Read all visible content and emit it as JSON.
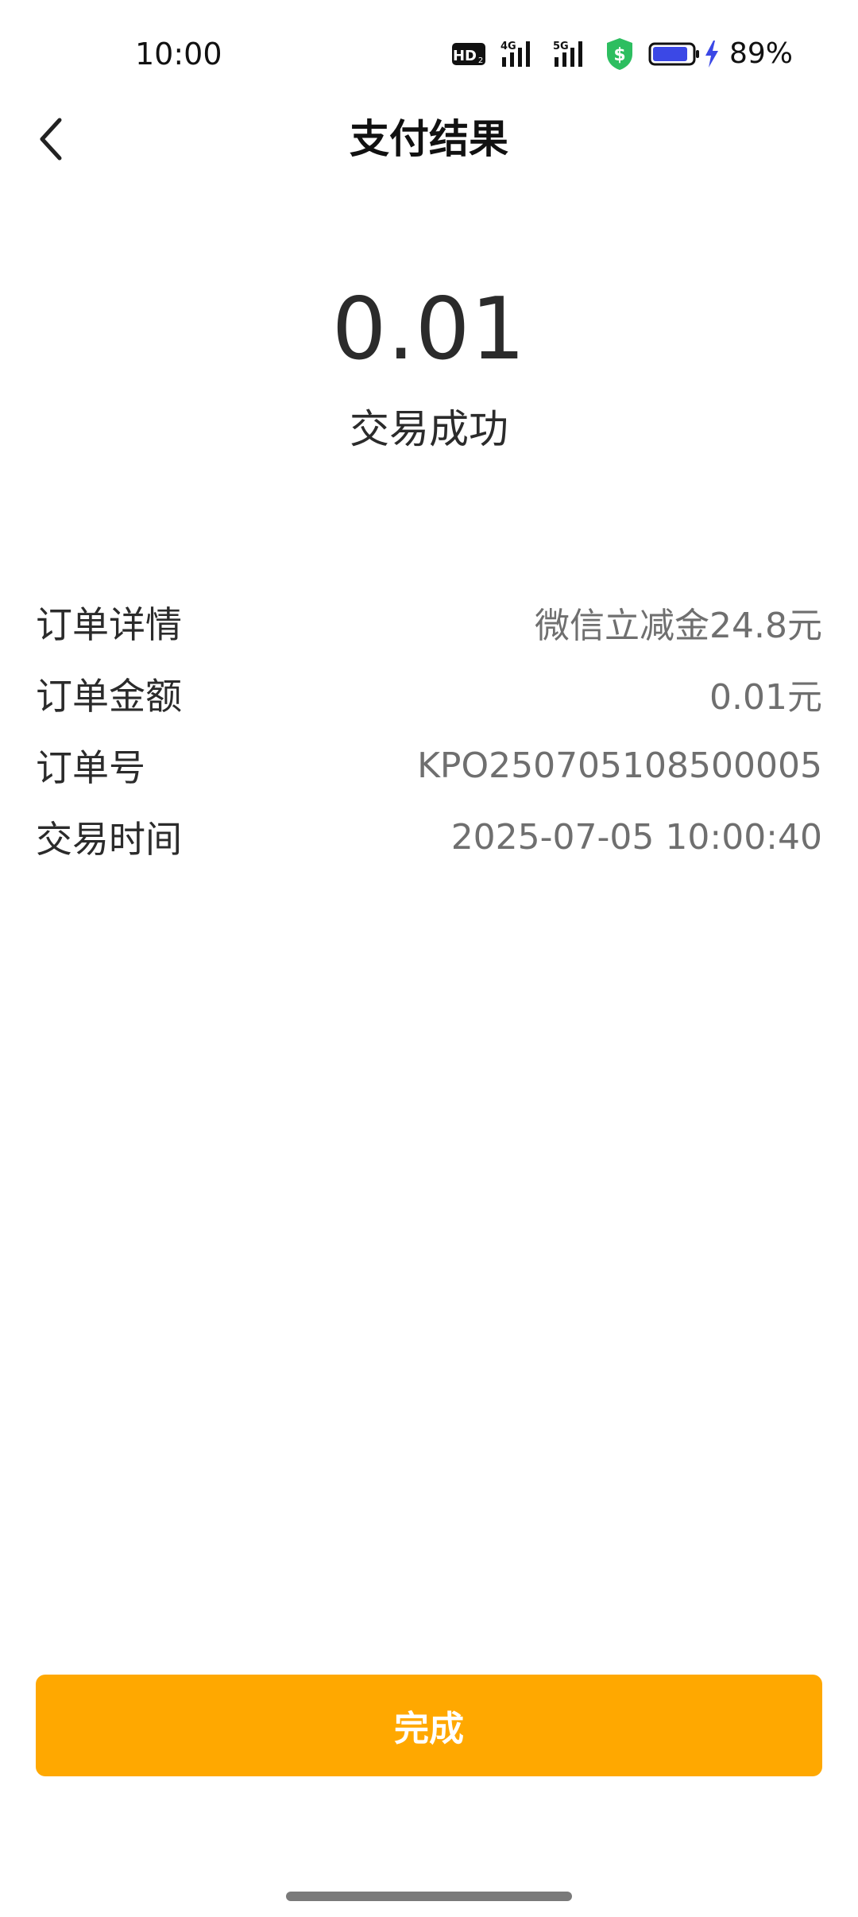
{
  "status_bar": {
    "time": "10:00",
    "icons": [
      "hd-icon",
      "signal-4g-icon",
      "signal-5g-icon",
      "shield-dollar-icon",
      "battery-icon",
      "charging-bolt-icon"
    ],
    "hd_text": "HD",
    "net1_text": "4G",
    "net2_text": "5G",
    "battery_percent": "89%",
    "battery_level": 0.89,
    "colors": {
      "shield": "#2DBE60",
      "battery_fill": "#3B48E6",
      "bolt": "#3B48E6"
    }
  },
  "nav": {
    "title": "支付结果",
    "back_icon": "chevron-left-icon"
  },
  "result": {
    "amount": "0.01",
    "status": "交易成功"
  },
  "details": [
    {
      "label": "订单详情",
      "value": "微信立减金24.8元"
    },
    {
      "label": "订单金额",
      "value": "0.01元"
    },
    {
      "label": "订单号",
      "value": "KPO250705108500005"
    },
    {
      "label": "交易时间",
      "value": "2025-07-05 10:00:40"
    }
  ],
  "actions": {
    "done_label": "完成",
    "done_color": "#FFA800"
  }
}
